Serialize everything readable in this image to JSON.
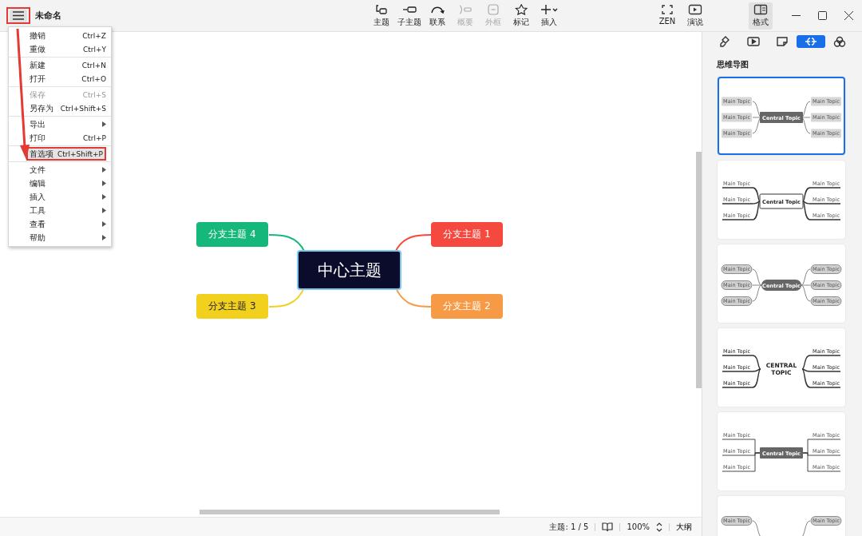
{
  "window": {
    "title": "未命名"
  },
  "toolbar": [
    {
      "label": "主题",
      "disabled": false
    },
    {
      "label": "子主题",
      "disabled": false
    },
    {
      "label": "联系",
      "disabled": false
    },
    {
      "label": "概要",
      "disabled": true
    },
    {
      "label": "外框",
      "disabled": true
    },
    {
      "label": "标记",
      "disabled": false
    },
    {
      "label": "插入",
      "disabled": false
    }
  ],
  "view_buttons": [
    {
      "label": "ZEN",
      "selected": false
    },
    {
      "label": "演说",
      "selected": false
    },
    {
      "label": "格式",
      "selected": true
    }
  ],
  "menu": [
    [
      {
        "label": "撤销",
        "shortcut": "Ctrl+Z",
        "submenu": false,
        "disabled": false,
        "highlighted": false
      },
      {
        "label": "重做",
        "shortcut": "Ctrl+Y",
        "submenu": false,
        "disabled": false,
        "highlighted": false
      }
    ],
    [
      {
        "label": "新建",
        "shortcut": "Ctrl+N",
        "submenu": false,
        "disabled": false,
        "highlighted": false
      },
      {
        "label": "打开",
        "shortcut": "Ctrl+O",
        "submenu": false,
        "disabled": false,
        "highlighted": false
      }
    ],
    [
      {
        "label": "保存",
        "shortcut": "Ctrl+S",
        "submenu": false,
        "disabled": true,
        "highlighted": false
      },
      {
        "label": "另存为",
        "shortcut": "Ctrl+Shift+S",
        "submenu": false,
        "disabled": false,
        "highlighted": false
      }
    ],
    [
      {
        "label": "导出",
        "submenu": true,
        "disabled": false,
        "highlighted": false
      },
      {
        "label": "打印",
        "shortcut": "Ctrl+P",
        "submenu": false,
        "disabled": false,
        "highlighted": false
      }
    ],
    [
      {
        "label": "首选项",
        "shortcut": "Ctrl+Shift+P",
        "submenu": false,
        "disabled": false,
        "highlighted": true
      }
    ],
    [
      {
        "label": "文件",
        "submenu": true,
        "disabled": false,
        "highlighted": false
      },
      {
        "label": "编辑",
        "submenu": true,
        "disabled": false,
        "highlighted": false
      },
      {
        "label": "插入",
        "submenu": true,
        "disabled": false,
        "highlighted": false
      },
      {
        "label": "工具",
        "submenu": true,
        "disabled": false,
        "highlighted": false
      },
      {
        "label": "查看",
        "submenu": true,
        "disabled": false,
        "highlighted": false
      },
      {
        "label": "帮助",
        "submenu": true,
        "disabled": false,
        "highlighted": false
      }
    ]
  ],
  "mindmap": {
    "central": "中心主题",
    "branches": [
      {
        "label": "分支主题 4",
        "color": "#15b87a"
      },
      {
        "label": "分支主题 1",
        "color": "#f5483f"
      },
      {
        "label": "分支主题 3",
        "color": "#f2d01e"
      },
      {
        "label": "分支主题 2",
        "color": "#f79a45"
      }
    ]
  },
  "panel": {
    "tabs": [
      {
        "selected": false
      },
      {
        "selected": false
      },
      {
        "selected": false
      },
      {
        "selected": true
      },
      {
        "selected": false
      }
    ],
    "heading": "思维导图",
    "templates": [
      {
        "kind": "filled",
        "selected": true,
        "central": [
          "Central Topic"
        ],
        "topics": [
          "Main Topic",
          "Main Topic",
          "Main Topic",
          "Main Topic",
          "Main Topic",
          "Main Topic"
        ]
      },
      {
        "kind": "underline",
        "selected": false,
        "central": [
          "Central Topic"
        ],
        "topics": [
          "Main Topic",
          "Main Topic",
          "Main Topic",
          "Main Topic",
          "Main Topic",
          "Main Topic"
        ]
      },
      {
        "kind": "pill",
        "selected": false,
        "central": [
          "Central Topic"
        ],
        "topics": [
          "Main Topic",
          "Main Topic",
          "Main Topic",
          "Main Topic",
          "Main Topic",
          "Main Topic"
        ]
      },
      {
        "kind": "caps",
        "selected": false,
        "central": [
          "CENTRAL",
          "TOPIC"
        ],
        "topics": [
          "Main Topic",
          "Main Topic",
          "Main Topic",
          "Main Topic",
          "Main Topic",
          "Main Topic"
        ]
      },
      {
        "kind": "elbow",
        "selected": false,
        "central": [
          "Central Topic"
        ],
        "topics": [
          "Main Topic",
          "Main Topic",
          "Main Topic",
          "Main Topic",
          "Main Topic",
          "Main Topic"
        ]
      },
      {
        "kind": "pill",
        "selected": false,
        "topics": [
          "Main Topic",
          "Main Topic"
        ]
      }
    ]
  },
  "status_bar": {
    "topics": "主题: 1 / 5",
    "zoom": "100%",
    "outline": "大纲"
  }
}
